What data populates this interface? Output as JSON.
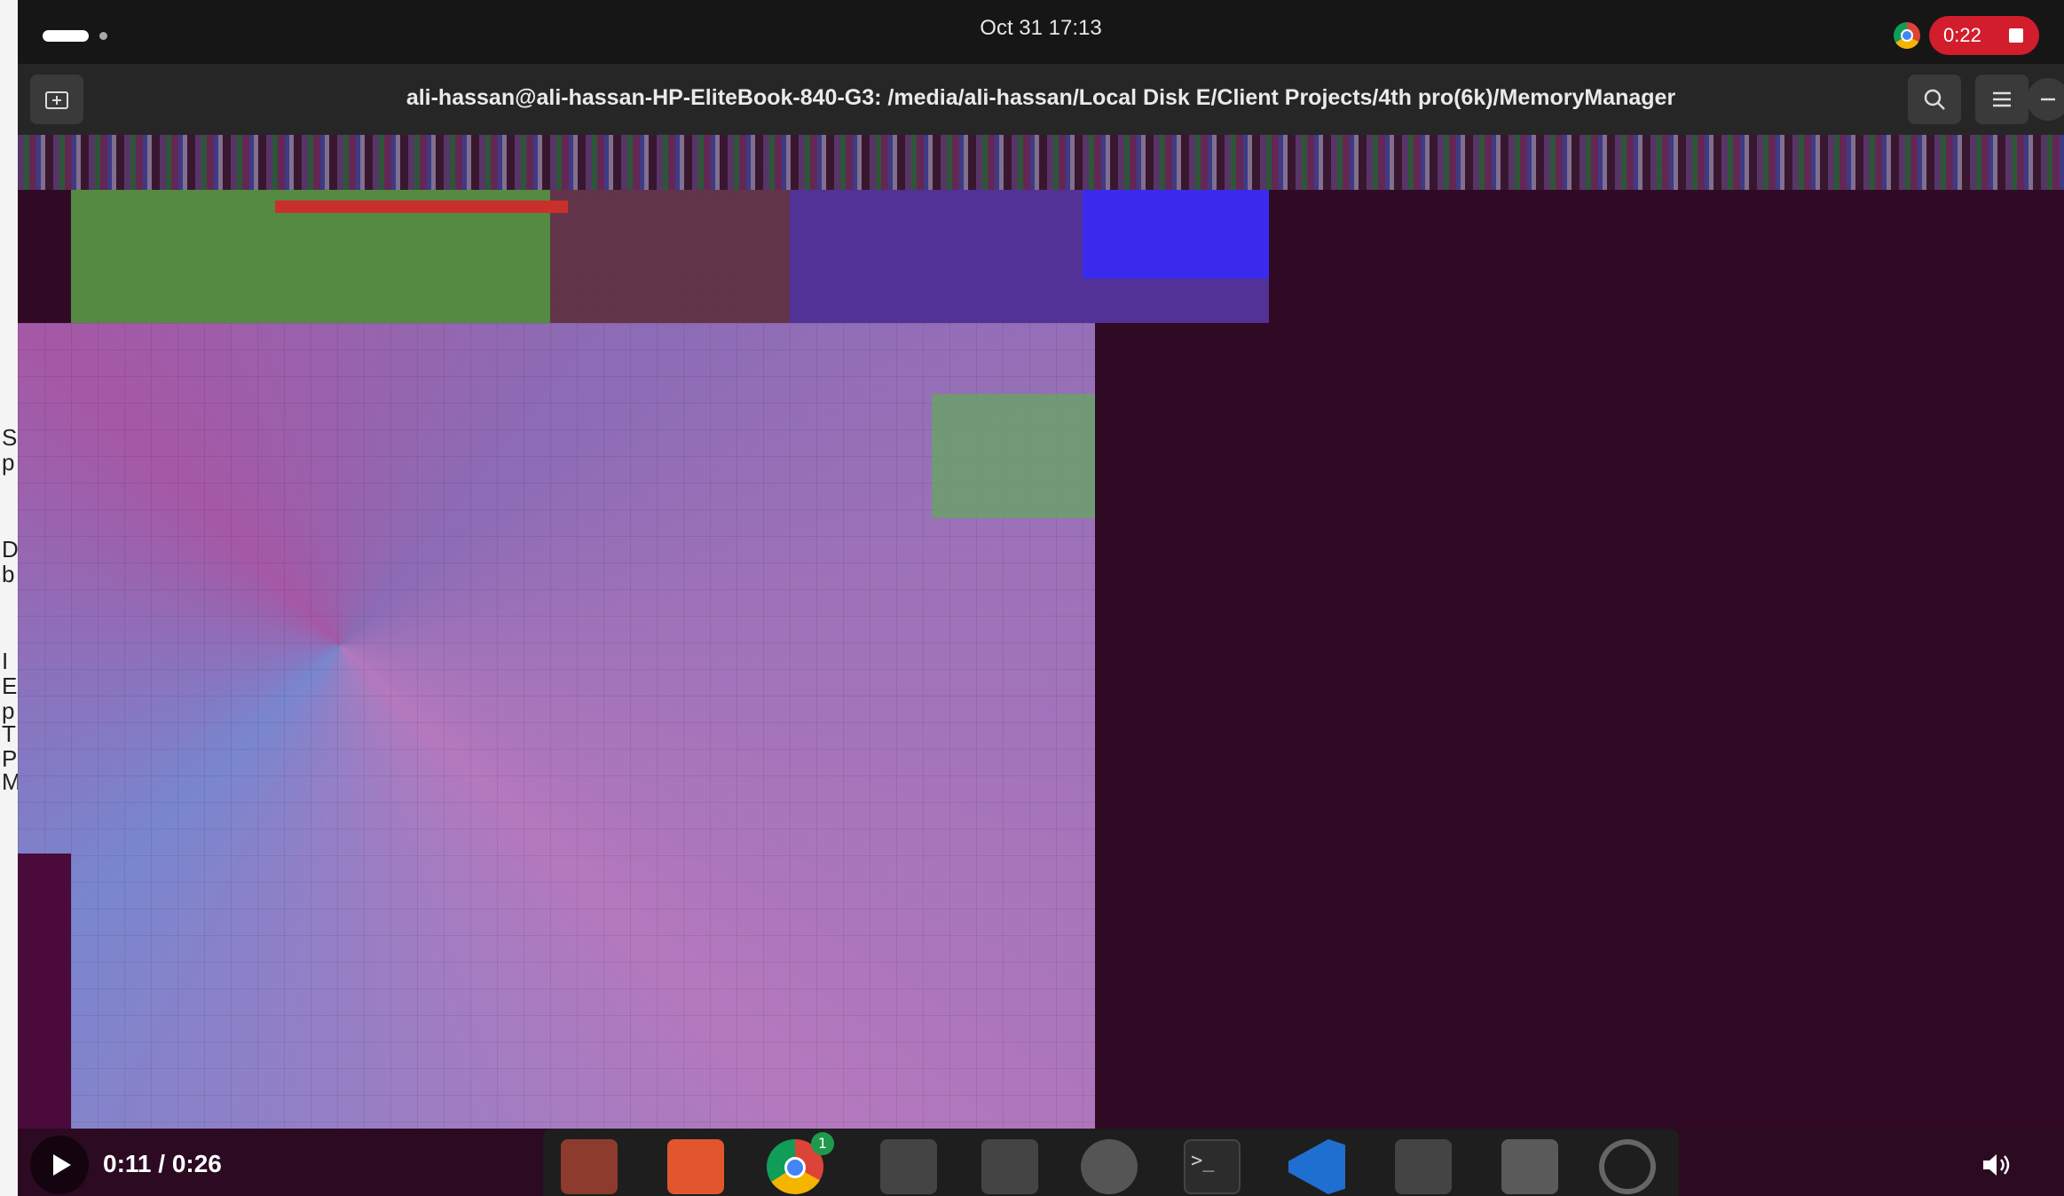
{
  "top_bar": {
    "clock": "Oct 31  17:13",
    "recording_label": "0:22"
  },
  "terminal": {
    "title": "ali-hassan@ali-hassan-HP-EliteBook-840-G3: /media/ali-hassan/Local Disk E/Client Projects/4th pro(6k)/MemoryManager",
    "new_tab_icon": "new-tab-icon",
    "search_icon": "search-icon",
    "menu_icon": "hamburger-menu-icon",
    "minimize_icon": "minimize-icon",
    "background_color": "#300a24"
  },
  "dock": {
    "items": [
      "files-icon",
      "app-store-icon",
      "chrome-icon",
      "app-icon",
      "app-icon",
      "settings-icon",
      "terminal-icon",
      "vscode-icon",
      "app-icon",
      "trash-icon",
      "ubuntu-icon"
    ],
    "chrome_badge": "1",
    "terminal_glyph": ">_"
  },
  "video": {
    "time_display": "0:11 / 0:26",
    "play_icon": "play-icon",
    "volume_icon": "volume-icon"
  },
  "left_strip": {
    "chars": [
      "S",
      "p",
      "D",
      "b",
      "I",
      "E",
      "p",
      "T",
      "P",
      "M"
    ]
  }
}
